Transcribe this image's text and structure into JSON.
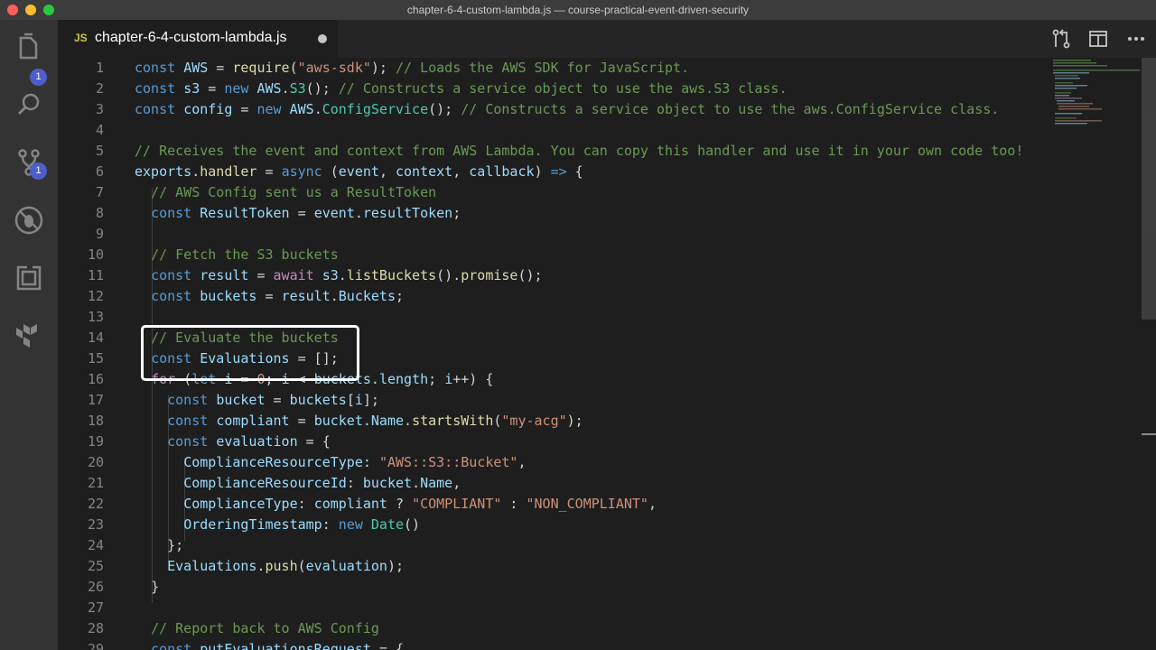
{
  "window": {
    "title": "chapter-6-4-custom-lambda.js — course-practical-event-driven-security",
    "traffic_lights": [
      "#ff5f57",
      "#febc2e",
      "#28c840"
    ]
  },
  "activity_bar": {
    "items": [
      {
        "name": "explorer",
        "icon": "files-icon",
        "badge": "1"
      },
      {
        "name": "search",
        "icon": "search-icon"
      },
      {
        "name": "source-control",
        "icon": "source-control-icon",
        "badge": "1"
      },
      {
        "name": "debug",
        "icon": "debug-icon"
      },
      {
        "name": "extensions",
        "icon": "extensions-icon"
      },
      {
        "name": "terraform",
        "icon": "terraform-icon"
      }
    ]
  },
  "tab": {
    "icon_text": "JS",
    "label": "chapter-6-4-custom-lambda.js",
    "dirty": true
  },
  "tab_actions": [
    "open-changes-icon",
    "split-editor-icon",
    "more-actions-icon"
  ],
  "editor": {
    "lines": [
      {
        "n": "1",
        "tokens": [
          [
            "kw",
            "const"
          ],
          [
            "",
            " "
          ],
          [
            "va",
            "AWS"
          ],
          [
            "",
            " = "
          ],
          [
            "fn",
            "require"
          ],
          [
            "",
            "("
          ],
          [
            "st",
            "\"aws-sdk\""
          ],
          [
            "",
            "); "
          ],
          [
            "cm",
            "// Loads the AWS SDK for JavaScript."
          ]
        ]
      },
      {
        "n": "2",
        "tokens": [
          [
            "kw",
            "const"
          ],
          [
            "",
            " "
          ],
          [
            "va",
            "s3"
          ],
          [
            "",
            " = "
          ],
          [
            "kw",
            "new"
          ],
          [
            "",
            " "
          ],
          [
            "va",
            "AWS"
          ],
          [
            "",
            "."
          ],
          [
            "cl",
            "S3"
          ],
          [
            "",
            "(); "
          ],
          [
            "cm",
            "// Constructs a service object to use the aws.S3 class."
          ]
        ]
      },
      {
        "n": "3",
        "tokens": [
          [
            "kw",
            "const"
          ],
          [
            "",
            " "
          ],
          [
            "va",
            "config"
          ],
          [
            "",
            " = "
          ],
          [
            "kw",
            "new"
          ],
          [
            "",
            " "
          ],
          [
            "va",
            "AWS"
          ],
          [
            "",
            "."
          ],
          [
            "cl",
            "ConfigService"
          ],
          [
            "",
            "(); "
          ],
          [
            "cm",
            "// Constructs a service object to use the aws.ConfigService class."
          ]
        ]
      },
      {
        "n": "4",
        "tokens": []
      },
      {
        "n": "5",
        "tokens": [
          [
            "cm",
            "// Receives the event and context from AWS Lambda. You can copy this handler and use it in your own code too!"
          ]
        ]
      },
      {
        "n": "6",
        "tokens": [
          [
            "va",
            "exports"
          ],
          [
            "",
            "."
          ],
          [
            "fn",
            "handler"
          ],
          [
            "",
            " = "
          ],
          [
            "kw",
            "async"
          ],
          [
            "",
            " ("
          ],
          [
            "va",
            "event"
          ],
          [
            "",
            " , "
          ],
          [
            "va",
            "context"
          ],
          [
            "",
            " , "
          ],
          [
            "va",
            "callback"
          ],
          [
            "",
            ") "
          ],
          [
            "kw",
            "=>"
          ],
          [
            "",
            " {"
          ]
        ]
      },
      {
        "n": "7",
        "tokens": [
          [
            "",
            "  "
          ],
          [
            "cm",
            "// AWS Config sent us a ResultToken"
          ]
        ]
      },
      {
        "n": "8",
        "tokens": [
          [
            "",
            "  "
          ],
          [
            "kw",
            "const"
          ],
          [
            "",
            " "
          ],
          [
            "va",
            "ResultToken"
          ],
          [
            "",
            " = "
          ],
          [
            "va",
            "event"
          ],
          [
            "",
            "."
          ],
          [
            "va",
            "resultToken"
          ],
          [
            ";",
            ";"
          ]
        ]
      },
      {
        "n": "9",
        "tokens": []
      },
      {
        "n": "10",
        "tokens": [
          [
            "",
            "  "
          ],
          [
            "cm",
            "// Fetch the S3 buckets"
          ]
        ]
      },
      {
        "n": "11",
        "tokens": [
          [
            "",
            "  "
          ],
          [
            "kw",
            "const"
          ],
          [
            "",
            " "
          ],
          [
            "va",
            "result"
          ],
          [
            "",
            " = "
          ],
          [
            "aw",
            "await"
          ],
          [
            "",
            " "
          ],
          [
            "va",
            "s3"
          ],
          [
            "",
            "."
          ],
          [
            "fn",
            "listBuckets"
          ],
          [
            "",
            "()."
          ],
          [
            "fn",
            "promise"
          ],
          [
            "",
            "();"
          ]
        ]
      },
      {
        "n": "12",
        "tokens": [
          [
            "",
            "  "
          ],
          [
            "kw",
            "const"
          ],
          [
            "",
            " "
          ],
          [
            "va",
            "buckets"
          ],
          [
            "",
            " = "
          ],
          [
            "va",
            "result"
          ],
          [
            "",
            "."
          ],
          [
            "va",
            "Buckets"
          ],
          [
            "",
            ";"
          ]
        ]
      },
      {
        "n": "13",
        "tokens": []
      },
      {
        "n": "14",
        "tokens": [
          [
            "",
            "  "
          ],
          [
            "cm",
            "// Evaluate the buckets"
          ]
        ]
      },
      {
        "n": "15",
        "tokens": [
          [
            "",
            "  "
          ],
          [
            "kw",
            "const"
          ],
          [
            "",
            " "
          ],
          [
            "va",
            "Evaluations"
          ],
          [
            "",
            " = [];"
          ]
        ]
      },
      {
        "n": "16",
        "tokens": [
          [
            "",
            "  "
          ],
          [
            "aw",
            "for"
          ],
          [
            "",
            " ("
          ],
          [
            "kw",
            "let"
          ],
          [
            "",
            " "
          ],
          [
            "va",
            "i"
          ],
          [
            "",
            " = "
          ],
          [
            "st",
            "0"
          ],
          [
            ";",
            ";"
          ],
          [
            "",
            " "
          ],
          [
            "va",
            "i"
          ],
          [
            "",
            " < "
          ],
          [
            "va",
            "buckets"
          ],
          [
            "",
            "."
          ],
          [
            "va",
            "length"
          ],
          [
            "",
            "; "
          ],
          [
            "va",
            "i"
          ],
          [
            "",
            "++) {"
          ]
        ]
      },
      {
        "n": "17",
        "tokens": [
          [
            "",
            "    "
          ],
          [
            "kw",
            "const"
          ],
          [
            "",
            " "
          ],
          [
            "va",
            "bucket"
          ],
          [
            "",
            " = "
          ],
          [
            "va",
            "buckets"
          ],
          [
            "",
            "["
          ],
          [
            "va",
            "i"
          ],
          [
            "",
            "];"
          ]
        ]
      },
      {
        "n": "18",
        "tokens": [
          [
            "",
            "    "
          ],
          [
            "kw",
            "const"
          ],
          [
            "",
            " "
          ],
          [
            "va",
            "compliant"
          ],
          [
            "",
            " = "
          ],
          [
            "va",
            "bucket"
          ],
          [
            "",
            "."
          ],
          [
            "va",
            "Name"
          ],
          [
            "",
            "."
          ],
          [
            "fn",
            "startsWith"
          ],
          [
            "",
            "("
          ],
          [
            "st",
            "\"my-acg\""
          ],
          [
            "",
            ");"
          ]
        ]
      },
      {
        "n": "19",
        "tokens": [
          [
            "",
            "    "
          ],
          [
            "kw",
            "const"
          ],
          [
            "",
            " "
          ],
          [
            "va",
            "evaluation"
          ],
          [
            "",
            " = {"
          ]
        ]
      },
      {
        "n": "20",
        "tokens": [
          [
            "",
            "      "
          ],
          [
            "pr",
            "ComplianceResourceType"
          ],
          [
            "",
            ": "
          ],
          [
            "st",
            "\"AWS::S3::Bucket\""
          ],
          [
            "",
            ","
          ]
        ]
      },
      {
        "n": "21",
        "tokens": [
          [
            "",
            "      "
          ],
          [
            "pr",
            "ComplianceResourceId"
          ],
          [
            "",
            ": "
          ],
          [
            "va",
            "bucket"
          ],
          [
            "",
            "."
          ],
          [
            "va",
            "Name"
          ],
          [
            "",
            ","
          ]
        ]
      },
      {
        "n": "22",
        "tokens": [
          [
            "",
            "      "
          ],
          [
            "pr",
            "ComplianceType"
          ],
          [
            "",
            ": "
          ],
          [
            "va",
            "compliant"
          ],
          [
            "",
            " ? "
          ],
          [
            "st",
            "\"COMPLIANT\""
          ],
          [
            "",
            " : "
          ],
          [
            "st",
            "\"NON_COMPLIANT\""
          ],
          [
            "",
            ","
          ]
        ]
      },
      {
        "n": "23",
        "tokens": [
          [
            "",
            "      "
          ],
          [
            "pr",
            "OrderingTimestamp"
          ],
          [
            "",
            ": "
          ],
          [
            "kw",
            "new"
          ],
          [
            "",
            " "
          ],
          [
            "cl",
            "Date"
          ],
          [
            "",
            "()"
          ]
        ]
      },
      {
        "n": "24",
        "tokens": [
          [
            "",
            "    "
          ],
          [
            "",
            "};"
          ]
        ]
      },
      {
        "n": "25",
        "tokens": [
          [
            "",
            "    "
          ],
          [
            "va",
            "Evaluations"
          ],
          [
            "",
            "."
          ],
          [
            "fn",
            "push"
          ],
          [
            "",
            "("
          ],
          [
            "va",
            "evaluation"
          ],
          [
            "",
            ");"
          ]
        ]
      },
      {
        "n": "26",
        "tokens": [
          [
            "",
            "  "
          ],
          [
            "",
            "}"
          ]
        ]
      },
      {
        "n": "27",
        "tokens": []
      },
      {
        "n": "28",
        "tokens": [
          [
            "",
            "  "
          ],
          [
            "cm",
            "// Report back to AWS Config"
          ]
        ]
      },
      {
        "n": "29",
        "tokens": [
          [
            "",
            "  "
          ],
          [
            "kw",
            "const"
          ],
          [
            "",
            " "
          ],
          [
            "va",
            "putEvaluationsRequest"
          ],
          [
            "",
            " = {"
          ]
        ]
      }
    ]
  }
}
